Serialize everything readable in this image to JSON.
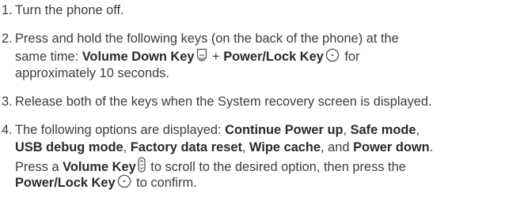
{
  "steps": [
    {
      "number": "1.",
      "text": "Turn the phone off."
    },
    {
      "number": "2.",
      "line1": "Press and hold the following keys (on the back of the phone) at the",
      "line2_a": "same time: ",
      "line2_b": "Volume Down Key",
      "line2_c": " + ",
      "line2_d": "Power/Lock Key",
      "line2_e": " for",
      "line3": "approximately 10 seconds."
    },
    {
      "number": "3.",
      "text": "Release both of the keys when the System recovery screen is displayed."
    },
    {
      "number": "4.",
      "line1_a": "The following options are displayed: ",
      "line1_b": "Continue Power up",
      "line1_c": ", ",
      "line1_d": "Safe mode",
      "line1_e": ",",
      "line2_a": "USB debug mode",
      "line2_b": ", ",
      "line2_c": "Factory data reset",
      "line2_d": ", ",
      "line2_e": "Wipe cache",
      "line2_f": ", and ",
      "line2_g": "Power down",
      "line2_h": ".",
      "line3_a": "Press a ",
      "line3_b": "Volume Key",
      "line3_c": " to scroll to the desired option, then press the",
      "line4_a": "Power/Lock Key",
      "line4_b": " to confirm."
    }
  ],
  "icons": {
    "volume_down": "volume-down-key-icon",
    "power_lock": "power-lock-key-icon",
    "volume": "volume-key-icon"
  }
}
